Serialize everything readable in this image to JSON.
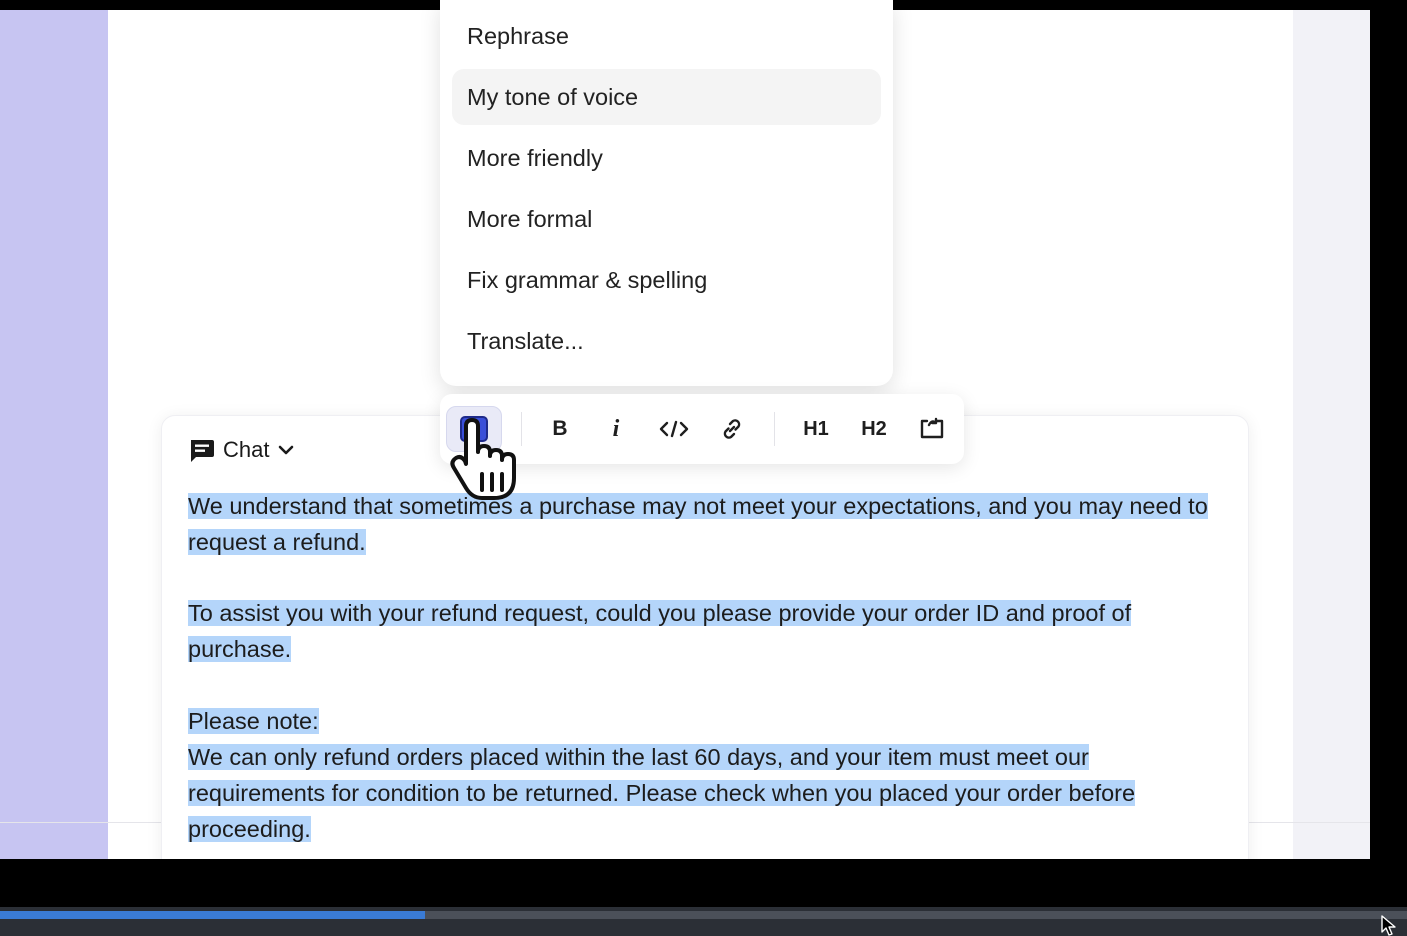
{
  "ai_menu": {
    "items": [
      {
        "label": "Rephrase",
        "active": false
      },
      {
        "label": "My tone of voice",
        "active": true
      },
      {
        "label": "More friendly",
        "active": false
      },
      {
        "label": "More formal",
        "active": false
      },
      {
        "label": "Fix grammar & spelling",
        "active": false
      },
      {
        "label": "Translate...",
        "active": false
      }
    ]
  },
  "toolbar": {
    "ai_button_icon": "ai-square-icon",
    "bold": "B",
    "italic": "i",
    "code_icon": "code-icon",
    "link_icon": "link-icon",
    "h1": "H1",
    "h2": "H2",
    "insert_icon": "embed-icon"
  },
  "composer": {
    "channel": "Chat",
    "channel_icon": "chat-bubble-icon",
    "message_paragraphs": [
      "We understand that sometimes a purchase may not meet your expectations, and you may need to request a refund.",
      "To assist you with your refund request, could you please provide your order ID and proof of purchase.",
      "Please note:",
      "We can only refund orders placed within the last 60 days, and your item must meet our requirements for condition to be returned. Please check when you placed your order before proceeding."
    ],
    "selection_color": "#b4d5fa"
  },
  "player": {
    "progress_fraction": 0.302,
    "progress_color": "#3a7bd5"
  },
  "colors": {
    "left_panel": "#c7c5f2",
    "accent": "#3a4fd8"
  }
}
